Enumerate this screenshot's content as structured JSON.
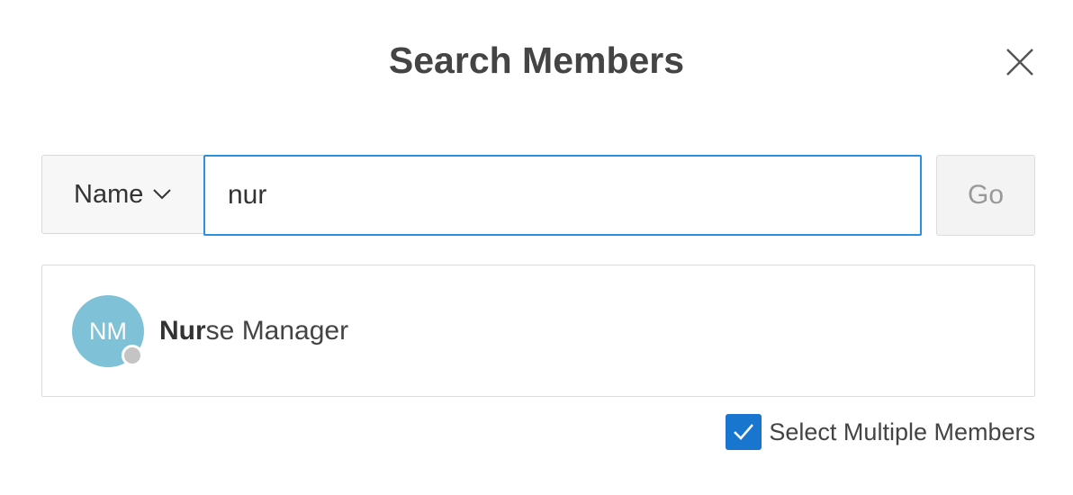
{
  "dialog": {
    "title": "Search Members",
    "close_icon": "close-icon"
  },
  "search": {
    "field_selector_label": "Name",
    "field_selector_icon": "chevron-down-icon",
    "query_value": "nur",
    "go_label": "Go"
  },
  "results": [
    {
      "initials": "NM",
      "name_match": "Nur",
      "name_rest": "se Manager",
      "avatar_color": "#7fc1d6",
      "presence_status": "offline"
    }
  ],
  "options": {
    "select_multiple_label": "Select Multiple Members",
    "select_multiple_checked": true
  },
  "colors": {
    "accent": "#1976cf",
    "input_focus_border": "#2c8fe0"
  }
}
